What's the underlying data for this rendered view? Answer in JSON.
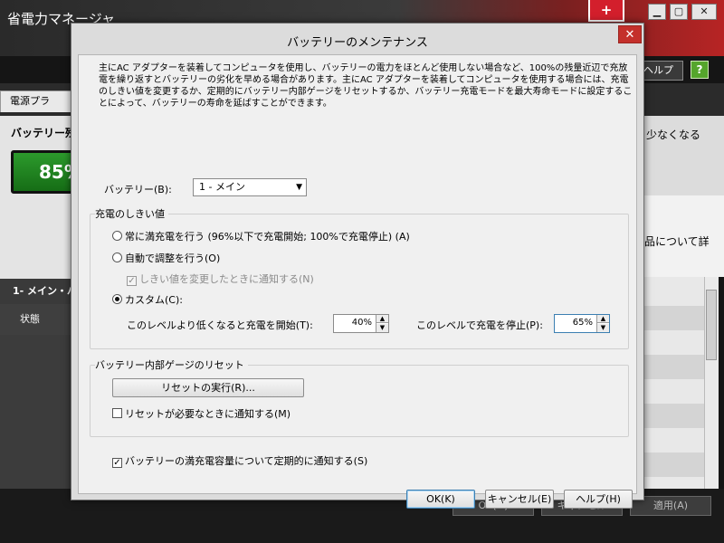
{
  "background_app": {
    "title": "省電力マネージャ",
    "window_controls": [
      "▁",
      "▢",
      "✕"
    ],
    "battery_logo": "+",
    "help_button_label": "ヘルプ(B)",
    "help_icon": "?",
    "tab_label": "電源プラ",
    "battery_panel_title": "バッテリー残",
    "battery_percent": "85%",
    "battery_row": "1- メイン・バ",
    "status_label": "状態",
    "right_text1": "少なくなる",
    "right_text2": "品について詳",
    "footer_buttons": [
      "OK(O)",
      "キャンセル",
      "適用(A)"
    ]
  },
  "dialog": {
    "title": "バッテリーのメンテナンス",
    "close_glyph": "✕",
    "description": "主にAC アダプターを装着してコンピュータを使用し、バッテリーの電力をほとんど使用しない場合など、100%の残量近辺で充放電を繰り返すとバッテリーの劣化を早める場合があります。主にAC アダプターを装着してコンピュータを使用する場合には、充電のしきい値を変更するか、定期的にバッテリー内部ゲージをリセットするか、バッテリー充電モードを最大寿命モードに設定することによって、バッテリーの寿命を延ばすことができます。",
    "battery_label": "バッテリー(B):",
    "battery_selected": "1 - メイン",
    "threshold": {
      "group_title": "充電のしきい値",
      "option_full": "常に満充電を行う (96%以下で充電開始; 100%で充電停止) (A)",
      "option_auto": "自動で調整を行う(O)",
      "notify_on_change": "しきい値を変更したときに通知する(N)",
      "option_custom": "カスタム(C):",
      "start_label": "このレベルより低くなると充電を開始(T):",
      "start_value": "40%",
      "stop_label": "このレベルで充電を停止(P):",
      "stop_value": "65%",
      "selected": "custom"
    },
    "gauge_reset": {
      "group_title": "バッテリー内部ゲージのリセット",
      "reset_button": "リセットの実行(R)...",
      "notify_when_needed": "リセットが必要なときに通知する(M)"
    },
    "periodic_notify": "バッテリーの満充電容量について定期的に通知する(S)",
    "buttons": {
      "ok": "OK(K)",
      "cancel": "キャンセル(E)",
      "help": "ヘルプ(H)"
    }
  }
}
